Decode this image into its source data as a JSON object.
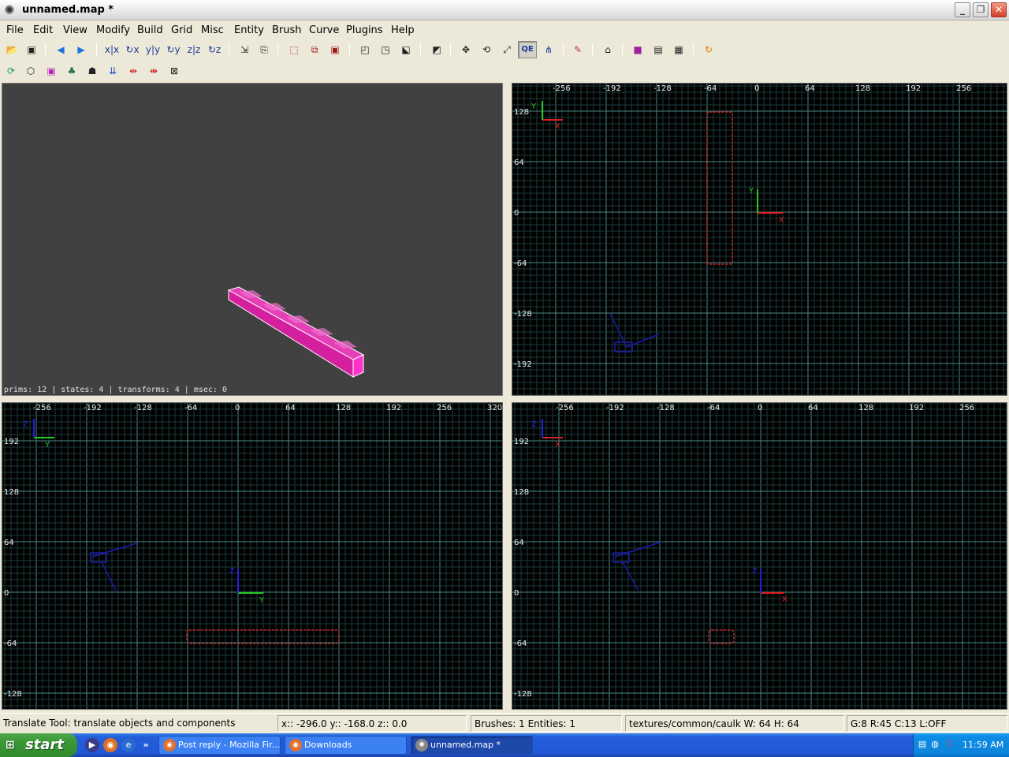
{
  "window": {
    "title": "unnamed.map *",
    "minimize_icon": "_",
    "maximize_icon": "❐",
    "close_icon": "✕"
  },
  "menu": [
    "File",
    "Edit",
    "View",
    "Modify",
    "Build",
    "Grid",
    "Misc",
    "Entity",
    "Brush",
    "Curve",
    "Plugins",
    "Help"
  ],
  "toolbar": {
    "qe_label": "QE"
  },
  "camera": {
    "stats": "prims: 12 | states: 4 | transforms: 4 | msec: 0",
    "brush_color": "#ff33cc"
  },
  "views": {
    "xy": {
      "x_ticks": [
        "-256",
        "-192",
        "-128",
        "-64",
        "0",
        "64",
        "128",
        "192",
        "256"
      ],
      "y_ticks": [
        "128",
        "64",
        "0",
        "-64",
        "-128",
        "-192"
      ],
      "axis_h": "X",
      "axis_v": "Y"
    },
    "xz": {
      "x_ticks": [
        "-256",
        "-192",
        "-128",
        "-64",
        "0",
        "64",
        "128",
        "192",
        "256",
        "320"
      ],
      "y_ticks": [
        "192",
        "128",
        "64",
        "0",
        "-64",
        "-128"
      ],
      "axis_h": "Y",
      "axis_v": "Z"
    },
    "yz": {
      "x_ticks": [
        "-256",
        "-192",
        "-128",
        "-64",
        "0",
        "64",
        "128",
        "192",
        "256"
      ],
      "y_ticks": [
        "192",
        "128",
        "64",
        "0",
        "-64",
        "-128"
      ],
      "axis_h": "X",
      "axis_v": "Z"
    }
  },
  "status": {
    "message": "Translate Tool: translate objects and components",
    "coords": "x:: -296.0  y:: -168.0  z::    0.0",
    "counts": "Brushes: 1 Entities: 1",
    "texture": "textures/common/caulk W: 64 H: 64",
    "grid": "G:8  R:45  C:13  L:OFF"
  },
  "taskbar": {
    "start": "start",
    "tasks": [
      "Post reply - Mozilla Fir...",
      "Downloads",
      "unnamed.map *"
    ],
    "clock": "11:59 AM"
  },
  "colors": {
    "grid_minor": "#1e3a3a",
    "grid_major": "#4a8a8a",
    "selection": "#cc2222",
    "entity": "#1a1aaa"
  }
}
